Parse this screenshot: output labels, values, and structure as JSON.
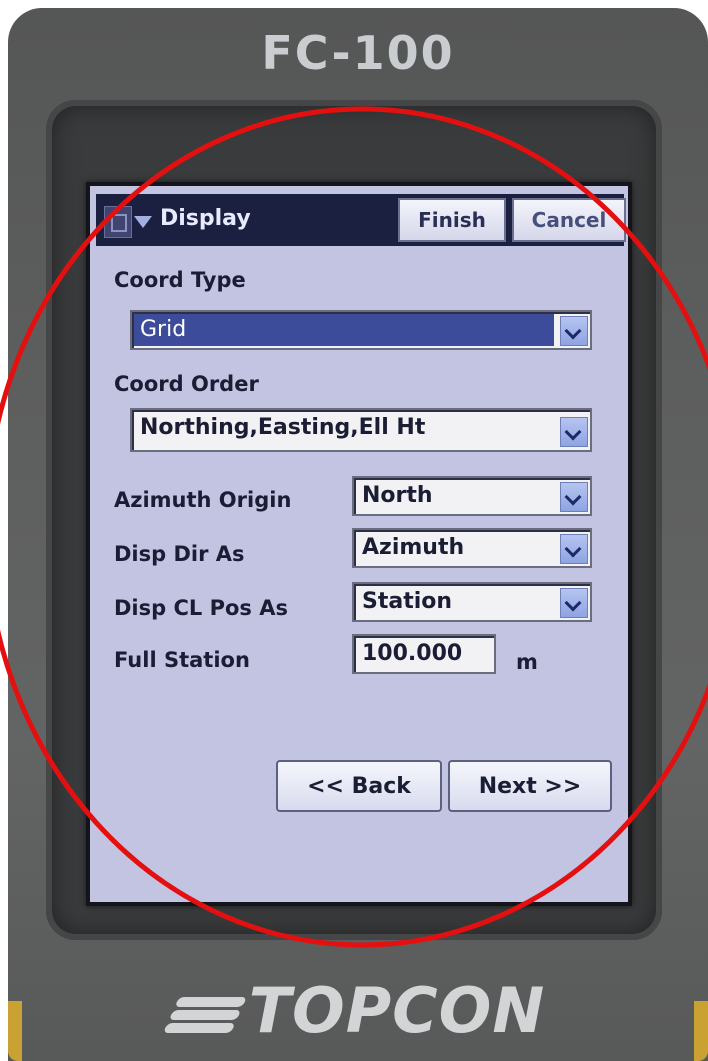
{
  "device": {
    "model": "FC-100",
    "brand": "TOPCON"
  },
  "titlebar": {
    "title": "Display",
    "finish_label": "Finish",
    "cancel_label": "Cancel"
  },
  "form": {
    "coord_type": {
      "label": "Coord Type",
      "value": "Grid"
    },
    "coord_order": {
      "label": "Coord Order",
      "value": "Northing,Easting,Ell Ht"
    },
    "azimuth_origin": {
      "label": "Azimuth Origin",
      "value": "North"
    },
    "disp_dir_as": {
      "label": "Disp Dir As",
      "value": "Azimuth"
    },
    "disp_cl_pos_as": {
      "label": "Disp CL Pos As",
      "value": "Station"
    },
    "full_station": {
      "label": "Full Station",
      "value": "100.000",
      "unit": "m"
    }
  },
  "nav": {
    "back_label": "<< Back",
    "next_label": "Next >>"
  },
  "colors": {
    "screen_bg": "#c2c4e2",
    "titlebar_bg": "#1c2040",
    "selection": "#3c4c9a",
    "annotation_circle": "#e41010",
    "device_body": "#5d5e5e"
  }
}
